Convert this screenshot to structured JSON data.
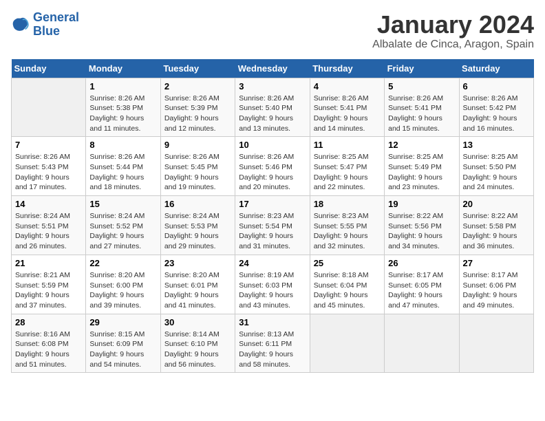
{
  "header": {
    "logo_line1": "General",
    "logo_line2": "Blue",
    "month": "January 2024",
    "location": "Albalate de Cinca, Aragon, Spain"
  },
  "weekdays": [
    "Sunday",
    "Monday",
    "Tuesday",
    "Wednesday",
    "Thursday",
    "Friday",
    "Saturday"
  ],
  "weeks": [
    [
      {
        "day": "",
        "info": ""
      },
      {
        "day": "1",
        "info": "Sunrise: 8:26 AM\nSunset: 5:38 PM\nDaylight: 9 hours\nand 11 minutes."
      },
      {
        "day": "2",
        "info": "Sunrise: 8:26 AM\nSunset: 5:39 PM\nDaylight: 9 hours\nand 12 minutes."
      },
      {
        "day": "3",
        "info": "Sunrise: 8:26 AM\nSunset: 5:40 PM\nDaylight: 9 hours\nand 13 minutes."
      },
      {
        "day": "4",
        "info": "Sunrise: 8:26 AM\nSunset: 5:41 PM\nDaylight: 9 hours\nand 14 minutes."
      },
      {
        "day": "5",
        "info": "Sunrise: 8:26 AM\nSunset: 5:41 PM\nDaylight: 9 hours\nand 15 minutes."
      },
      {
        "day": "6",
        "info": "Sunrise: 8:26 AM\nSunset: 5:42 PM\nDaylight: 9 hours\nand 16 minutes."
      }
    ],
    [
      {
        "day": "7",
        "info": "Sunrise: 8:26 AM\nSunset: 5:43 PM\nDaylight: 9 hours\nand 17 minutes."
      },
      {
        "day": "8",
        "info": "Sunrise: 8:26 AM\nSunset: 5:44 PM\nDaylight: 9 hours\nand 18 minutes."
      },
      {
        "day": "9",
        "info": "Sunrise: 8:26 AM\nSunset: 5:45 PM\nDaylight: 9 hours\nand 19 minutes."
      },
      {
        "day": "10",
        "info": "Sunrise: 8:26 AM\nSunset: 5:46 PM\nDaylight: 9 hours\nand 20 minutes."
      },
      {
        "day": "11",
        "info": "Sunrise: 8:25 AM\nSunset: 5:47 PM\nDaylight: 9 hours\nand 22 minutes."
      },
      {
        "day": "12",
        "info": "Sunrise: 8:25 AM\nSunset: 5:49 PM\nDaylight: 9 hours\nand 23 minutes."
      },
      {
        "day": "13",
        "info": "Sunrise: 8:25 AM\nSunset: 5:50 PM\nDaylight: 9 hours\nand 24 minutes."
      }
    ],
    [
      {
        "day": "14",
        "info": "Sunrise: 8:24 AM\nSunset: 5:51 PM\nDaylight: 9 hours\nand 26 minutes."
      },
      {
        "day": "15",
        "info": "Sunrise: 8:24 AM\nSunset: 5:52 PM\nDaylight: 9 hours\nand 27 minutes."
      },
      {
        "day": "16",
        "info": "Sunrise: 8:24 AM\nSunset: 5:53 PM\nDaylight: 9 hours\nand 29 minutes."
      },
      {
        "day": "17",
        "info": "Sunrise: 8:23 AM\nSunset: 5:54 PM\nDaylight: 9 hours\nand 31 minutes."
      },
      {
        "day": "18",
        "info": "Sunrise: 8:23 AM\nSunset: 5:55 PM\nDaylight: 9 hours\nand 32 minutes."
      },
      {
        "day": "19",
        "info": "Sunrise: 8:22 AM\nSunset: 5:56 PM\nDaylight: 9 hours\nand 34 minutes."
      },
      {
        "day": "20",
        "info": "Sunrise: 8:22 AM\nSunset: 5:58 PM\nDaylight: 9 hours\nand 36 minutes."
      }
    ],
    [
      {
        "day": "21",
        "info": "Sunrise: 8:21 AM\nSunset: 5:59 PM\nDaylight: 9 hours\nand 37 minutes."
      },
      {
        "day": "22",
        "info": "Sunrise: 8:20 AM\nSunset: 6:00 PM\nDaylight: 9 hours\nand 39 minutes."
      },
      {
        "day": "23",
        "info": "Sunrise: 8:20 AM\nSunset: 6:01 PM\nDaylight: 9 hours\nand 41 minutes."
      },
      {
        "day": "24",
        "info": "Sunrise: 8:19 AM\nSunset: 6:03 PM\nDaylight: 9 hours\nand 43 minutes."
      },
      {
        "day": "25",
        "info": "Sunrise: 8:18 AM\nSunset: 6:04 PM\nDaylight: 9 hours\nand 45 minutes."
      },
      {
        "day": "26",
        "info": "Sunrise: 8:17 AM\nSunset: 6:05 PM\nDaylight: 9 hours\nand 47 minutes."
      },
      {
        "day": "27",
        "info": "Sunrise: 8:17 AM\nSunset: 6:06 PM\nDaylight: 9 hours\nand 49 minutes."
      }
    ],
    [
      {
        "day": "28",
        "info": "Sunrise: 8:16 AM\nSunset: 6:08 PM\nDaylight: 9 hours\nand 51 minutes."
      },
      {
        "day": "29",
        "info": "Sunrise: 8:15 AM\nSunset: 6:09 PM\nDaylight: 9 hours\nand 54 minutes."
      },
      {
        "day": "30",
        "info": "Sunrise: 8:14 AM\nSunset: 6:10 PM\nDaylight: 9 hours\nand 56 minutes."
      },
      {
        "day": "31",
        "info": "Sunrise: 8:13 AM\nSunset: 6:11 PM\nDaylight: 9 hours\nand 58 minutes."
      },
      {
        "day": "",
        "info": ""
      },
      {
        "day": "",
        "info": ""
      },
      {
        "day": "",
        "info": ""
      }
    ]
  ]
}
